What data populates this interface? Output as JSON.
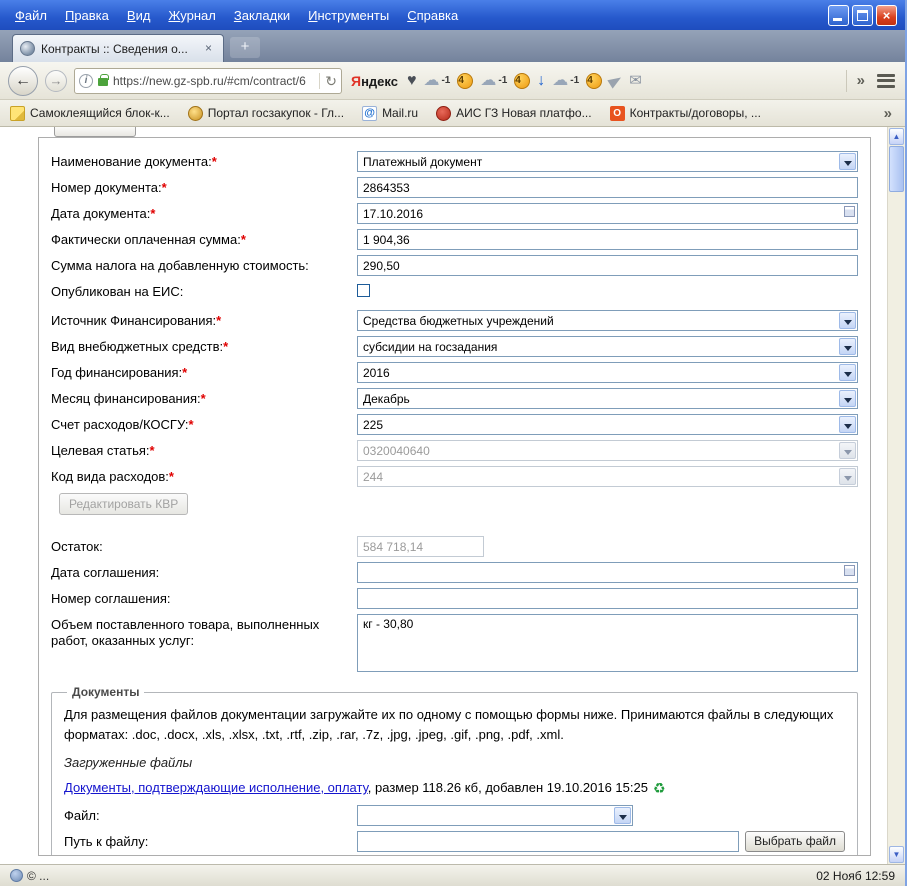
{
  "colors": {
    "titlebar": "#2659CC",
    "close_button": "#D9401F",
    "link": "#1515CE",
    "required": "#E00000",
    "coin": "#EE9B12"
  },
  "menubar": {
    "items": [
      "Файл",
      "Правка",
      "Вид",
      "Журнал",
      "Закладки",
      "Инструменты",
      "Справка"
    ]
  },
  "tabbar": {
    "active_tab": "Контракты :: Сведения о...",
    "close_glyph": "×",
    "new_tab_glyph": "+"
  },
  "navbar": {
    "url": "https://new.gz-spb.ru/#cm/contract/6",
    "reload_glyph": "↻",
    "yandex_first": "Я",
    "yandex_rest": "ндекс",
    "badges": [
      "-1",
      "4",
      "-1",
      "4",
      "-1",
      "4"
    ],
    "overflow_glyph": "»"
  },
  "bookmarks": {
    "items": [
      {
        "label": "Самоклеящийся блок-к..."
      },
      {
        "label": "Портал госзакупок - Гл..."
      },
      {
        "label": "Mail.ru"
      },
      {
        "label": "АИС ГЗ Новая платфо..."
      },
      {
        "label": "Контракты/договоры, ..."
      }
    ],
    "overflow_glyph": "»"
  },
  "form": {
    "fields": [
      {
        "label": "Наименование документа:",
        "req": "*",
        "value": "Платежный документ"
      },
      {
        "label": "Номер документа:",
        "req": "*",
        "value": "2864353"
      },
      {
        "label": "Дата документа:",
        "req": "*",
        "value": "17.10.2016"
      },
      {
        "label": "Фактически оплаченная сумма:",
        "req": "*",
        "value": "1 904,36"
      },
      {
        "label": "Сумма налога на добавленную стоимость:",
        "req": "",
        "value": "290,50"
      },
      {
        "label": "Опубликован на ЕИС:",
        "req": "",
        "value": ""
      },
      {
        "label": "Источник Финансирования:",
        "req": "*",
        "value": "Средства бюджетных учреждений"
      },
      {
        "label": "Вид внебюджетных средств:",
        "req": "*",
        "value": "субсидии на госзадания"
      },
      {
        "label": "Год финансирования:",
        "req": "*",
        "value": "2016"
      },
      {
        "label": "Месяц финансирования:",
        "req": "*",
        "value": "Декабрь"
      },
      {
        "label": "Счет расходов/КОСГУ:",
        "req": "*",
        "value": "225"
      },
      {
        "label": "Целевая статья:",
        "req": "*",
        "value": "0320040640"
      },
      {
        "label": "Код вида расходов:",
        "req": "*",
        "value": "244"
      },
      {
        "label": "Остаток:",
        "req": "",
        "value": "584 718,14"
      },
      {
        "label": "Дата соглашения:",
        "req": "",
        "value": ""
      },
      {
        "label": "Номер соглашения:",
        "req": "",
        "value": ""
      },
      {
        "label": "Объем поставленного товара, выполненных работ, оказанных услуг:",
        "req": "",
        "value": "кг - 30,80"
      }
    ],
    "edit_kvr_button": "Редактировать КВР"
  },
  "documents": {
    "legend": "Документы",
    "intro": "Для размещения файлов документации загружайте их по одному с помощью формы ниже. Принимаются файлы в следующих форматах: .doc, .docx, .xls, .xlsx, .txt, .rtf, .zip, .rar, .7z, .jpg, .jpeg, .gif, .png, .pdf, .xml.",
    "uploaded_title": "Загруженные файлы",
    "file_link": "Документы, подтверждающие исполнение, оплату",
    "file_meta": ", размер 118.26 кб, добавлен 19.10.2016 15:25",
    "file_label": "Файл:",
    "path_label": "Путь к файлу:",
    "choose_button": "Выбрать файл"
  },
  "statusbar": {
    "left": "© ...",
    "clock": "02 Нояб 12:59"
  }
}
